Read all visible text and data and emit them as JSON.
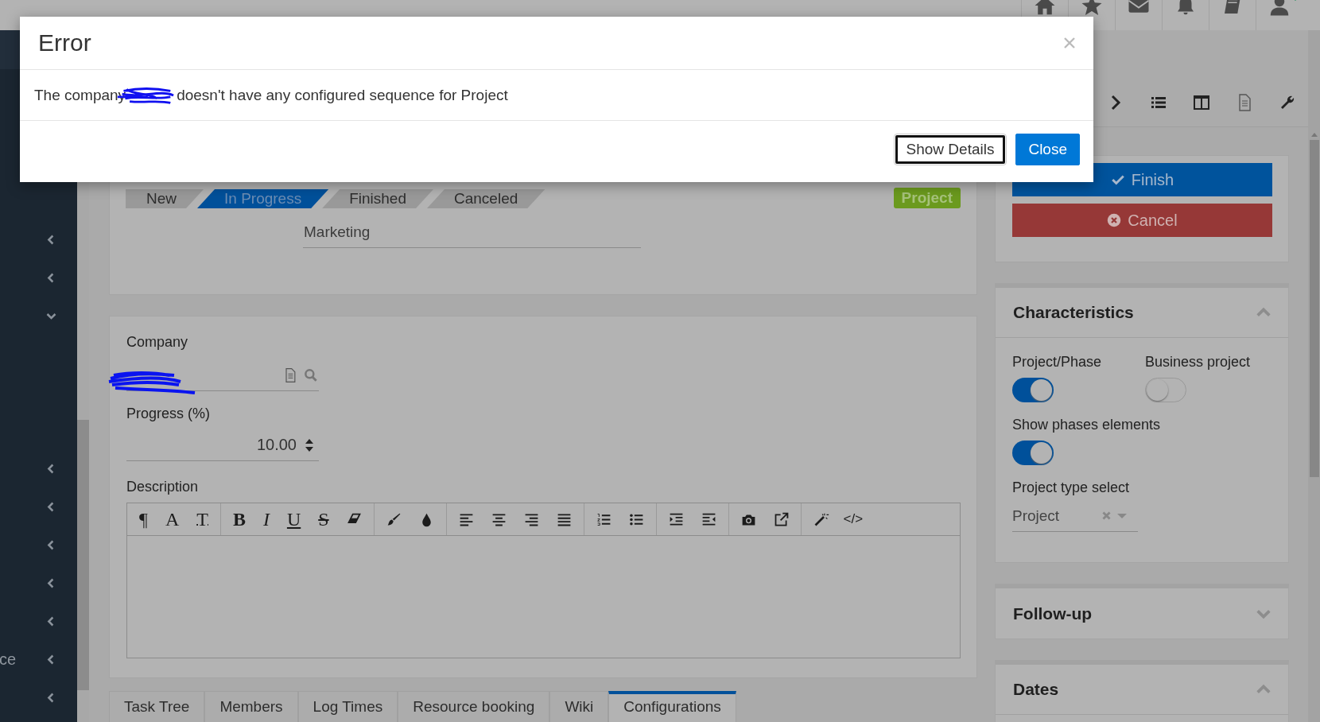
{
  "sidebar": {
    "items": [
      {
        "expanded": false
      },
      {
        "expanded": false
      },
      {
        "expanded": true
      },
      {
        "expanded": false
      },
      {
        "expanded": false
      },
      {
        "expanded": false
      },
      {
        "expanded": false
      },
      {
        "expanded": false
      },
      {
        "expanded": false,
        "label": "ce"
      },
      {
        "expanded": false
      }
    ]
  },
  "stepper": {
    "steps": [
      {
        "label": "New",
        "selected": false
      },
      {
        "label": "In Progress",
        "selected": true
      },
      {
        "label": "Finished",
        "selected": false
      },
      {
        "label": "Canceled",
        "selected": false
      }
    ]
  },
  "type_badge": "Project",
  "name_field": {
    "value": "Marketing"
  },
  "company": {
    "label": "Company"
  },
  "progress": {
    "label": "Progress (%)",
    "value": "10.00"
  },
  "description": {
    "label": "Description",
    "toolbar": [
      [
        {
          "kind": "paragraph",
          "glyph": "¶"
        },
        {
          "kind": "font",
          "glyph": "A"
        },
        {
          "kind": "size",
          "glyph": "T"
        }
      ],
      [
        {
          "kind": "bold",
          "glyph": "B"
        },
        {
          "kind": "italic",
          "glyph": "I"
        },
        {
          "kind": "underline",
          "glyph": "U"
        },
        {
          "kind": "strike",
          "glyph": "S"
        },
        {
          "kind": "eraser"
        }
      ],
      [
        {
          "kind": "brush"
        },
        {
          "kind": "drop"
        }
      ],
      [
        {
          "kind": "alignleft"
        },
        {
          "kind": "aligncenter"
        },
        {
          "kind": "alignright"
        },
        {
          "kind": "justify"
        }
      ],
      [
        {
          "kind": "numbered"
        },
        {
          "kind": "bulleted"
        }
      ],
      [
        {
          "kind": "indent"
        },
        {
          "kind": "outdent"
        }
      ],
      [
        {
          "kind": "camera"
        },
        {
          "kind": "external"
        }
      ],
      [
        {
          "kind": "magic"
        },
        {
          "kind": "code",
          "glyph": "</>"
        }
      ]
    ]
  },
  "tabs": [
    {
      "label": "Task Tree",
      "selected": false
    },
    {
      "label": "Members",
      "selected": false
    },
    {
      "label": "Log Times",
      "selected": false
    },
    {
      "label": "Resource booking",
      "selected": false
    },
    {
      "label": "Wiki",
      "selected": false
    },
    {
      "label": "Configurations",
      "selected": true
    }
  ],
  "actions": [
    {
      "kind": "finish",
      "label": "Finish"
    },
    {
      "kind": "cancel",
      "label": "Cancel"
    }
  ],
  "characteristics": {
    "title": "Characteristics",
    "expanded": true,
    "toggles": [
      {
        "label": "Project/Phase",
        "on": true
      },
      {
        "label": "Business project",
        "on": false
      },
      {
        "label": "Show phases elements",
        "on": true
      }
    ],
    "project_type": {
      "label": "Project type select",
      "value": "Project"
    }
  },
  "panels": [
    {
      "title": "Follow-up",
      "expanded": false
    },
    {
      "title": "Dates",
      "expanded": true
    }
  ],
  "dialog": {
    "title": "Error",
    "message_start": "The company",
    "message_end": "doesn't have any configured sequence for Project",
    "buttons": [
      {
        "kind": "secondary",
        "label": "Show Details",
        "focused": true
      },
      {
        "kind": "primary",
        "label": "Close",
        "focused": false
      }
    ]
  }
}
